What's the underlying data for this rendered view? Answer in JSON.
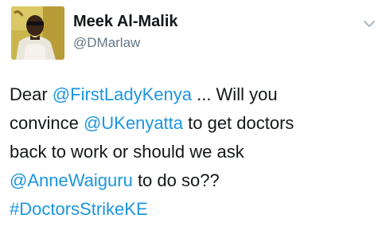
{
  "author": {
    "name": "Meek Al-Malik",
    "handle": "@DMarlaw"
  },
  "menu": {
    "icon": "chevron-down-icon"
  },
  "tweet": {
    "lines": [
      {
        "segments": [
          {
            "text": "Dear ",
            "type": "text"
          },
          {
            "text": "@FirstLadyKenya",
            "type": "mention"
          },
          {
            "text": " ... Will you",
            "type": "text"
          }
        ]
      },
      {
        "segments": [
          {
            "text": "convince ",
            "type": "text"
          },
          {
            "text": "@UKenyatta",
            "type": "mention"
          },
          {
            "text": " to get doctors",
            "type": "text"
          }
        ]
      },
      {
        "segments": [
          {
            "text": "back to work or should we ask",
            "type": "text"
          }
        ]
      },
      {
        "segments": [
          {
            "text": "@AnneWaiguru",
            "type": "mention"
          },
          {
            "text": " to do so??",
            "type": "text"
          }
        ]
      },
      {
        "segments": [
          {
            "text": "#DoctorsStrikeKE",
            "type": "hashtag"
          }
        ]
      }
    ]
  },
  "colors": {
    "link": "#1b95e0",
    "text": "#14171a",
    "handle": "#657786"
  }
}
